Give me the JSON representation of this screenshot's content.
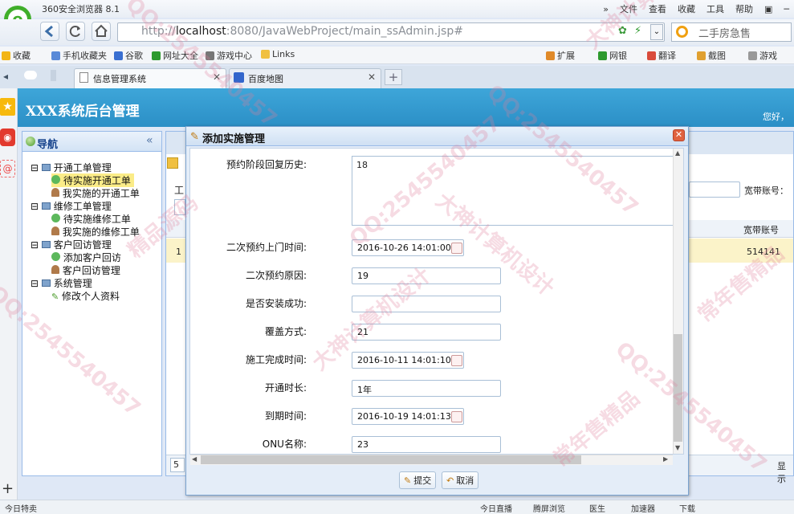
{
  "browser": {
    "window_title": "360安全浏览器 8.1",
    "menu": [
      "文件",
      "查看",
      "收藏",
      "工具",
      "帮助"
    ],
    "url_prefix": "http://",
    "url_host": "localhost",
    "url_rest": ":8080/JavaWebProject/main_ssAdmin.jsp#",
    "search_placeholder": "二手房急售",
    "favorites": [
      "收藏",
      "手机收藏夹",
      "谷歌",
      "网址大全",
      "游戏中心",
      "Links"
    ],
    "toolbar_right": [
      "扩展",
      "网银",
      "翻译",
      "截图",
      "游戏"
    ],
    "tabs": [
      "信息管理系统",
      "百度地图"
    ],
    "status_left": "今日特卖",
    "status_right": [
      "今日直播",
      "腾屏浏览",
      "医生",
      "加速器",
      "下载"
    ]
  },
  "app": {
    "title": "XXX系统后台管理",
    "greeting": "您好，"
  },
  "nav": {
    "title": "导航",
    "groups": [
      {
        "label": "开通工单管理",
        "items": [
          "待实施开通工单",
          "我实施的开通工单"
        ]
      },
      {
        "label": "维修工单管理",
        "items": [
          "待实施维修工单",
          "我实施的维修工单"
        ]
      },
      {
        "label": "客户回访管理",
        "items": [
          "添加客户回访",
          "客户回访管理"
        ]
      },
      {
        "label": "系统管理",
        "items": [
          "修改个人资料"
        ]
      }
    ]
  },
  "main": {
    "toolbar_fragment": "工",
    "broadband_account_label": "宽带账号：",
    "column_header": "宽带账号",
    "row_index": "1",
    "row_account": "514141",
    "pager_value": "5",
    "pager_right": "显示"
  },
  "dialog": {
    "title": "添加实施管理",
    "history_label": "预约阶段回复历史:",
    "history_value": "18",
    "fields": [
      {
        "label": "二次预约上门时间:",
        "value": "2016-10-26 14:01:00",
        "type": "date"
      },
      {
        "label": "二次预约原因:",
        "value": "19",
        "type": "text"
      },
      {
        "label": "是否安装成功:",
        "value": "",
        "type": "text"
      },
      {
        "label": "覆盖方式:",
        "value": "21",
        "type": "text"
      },
      {
        "label": "施工完成时间:",
        "value": "2016-10-11 14:01:10",
        "type": "date"
      },
      {
        "label": "开通时长:",
        "value": "1年",
        "type": "text"
      },
      {
        "label": "到期时间:",
        "value": "2016-10-19 14:01:13",
        "type": "date"
      },
      {
        "label": "ONU名称:",
        "value": "23",
        "type": "text"
      }
    ],
    "submit_label": "提交",
    "cancel_label": "取消"
  },
  "watermark": {
    "qq": "QQ:2545540457",
    "studio": "大神计算机设计",
    "brand1": "精品源码",
    "brand2": "常年售精品"
  }
}
